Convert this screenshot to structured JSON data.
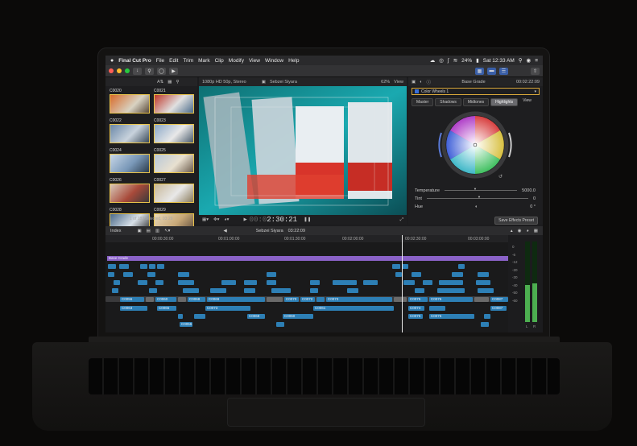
{
  "menubar": {
    "apple": "",
    "app_name": "Final Cut Pro",
    "items": [
      "File",
      "Edit",
      "Trim",
      "Mark",
      "Clip",
      "Modify",
      "View",
      "Window",
      "Help"
    ],
    "battery": "24%",
    "clock": "Sat 12:33 AM"
  },
  "browser": {
    "format": "1080p HD 50p, Stereo",
    "clips": [
      "C0020",
      "C0021",
      "C0022",
      "C0023",
      "C0024",
      "C0025",
      "C0026",
      "C0027",
      "C0028",
      "C0029"
    ],
    "selection_status": "1 of 183 selected, 03:29"
  },
  "viewer": {
    "project": "Sebzei Siyara",
    "zoom": "62%",
    "view_label": "View",
    "timecode_prefix": "00:0",
    "timecode": "2:30:21"
  },
  "inspector": {
    "title": "Base Grade",
    "duration": "00:02:22:09",
    "effect": "Color Wheels 1",
    "tabs": [
      "Master",
      "Shadows",
      "Midtones",
      "Highlights"
    ],
    "view_label": "View",
    "params": [
      {
        "label": "Temperature",
        "value": "5000.0"
      },
      {
        "label": "Tint",
        "value": "0"
      },
      {
        "label": "Hue",
        "value": "0 °"
      }
    ],
    "save_button": "Save Effects Preset"
  },
  "timeline": {
    "index_label": "Index",
    "project": "Sebzei Siyara",
    "duration": "03:22:09",
    "ruler": [
      "00:00:00:00",
      "00:00:30:00",
      "00:01:00:00",
      "00:01:30:00",
      "00:02:00:00",
      "00:02:30:00",
      "00:03:00:00"
    ],
    "base_grade_label": "Base Grade",
    "clip_labels": [
      "C0056",
      "C0060",
      "C0068",
      "C0069",
      "C0070",
      "C0072",
      "C0073",
      "C0074",
      "C0075",
      "C0076",
      "C0086",
      "C0087",
      "C0063",
      "C0065",
      "C0061"
    ]
  },
  "meters": {
    "scale": [
      "0",
      "-6",
      "-12",
      "-20",
      "-30",
      "-40",
      "-50",
      "-60"
    ],
    "channels": [
      "L",
      "R"
    ]
  },
  "colors": {
    "accent": "#3a5fa8",
    "clip_blue": "#2d7fb5",
    "grade_purple": "#8a62c7",
    "selection_yellow": "#e8c34a"
  }
}
